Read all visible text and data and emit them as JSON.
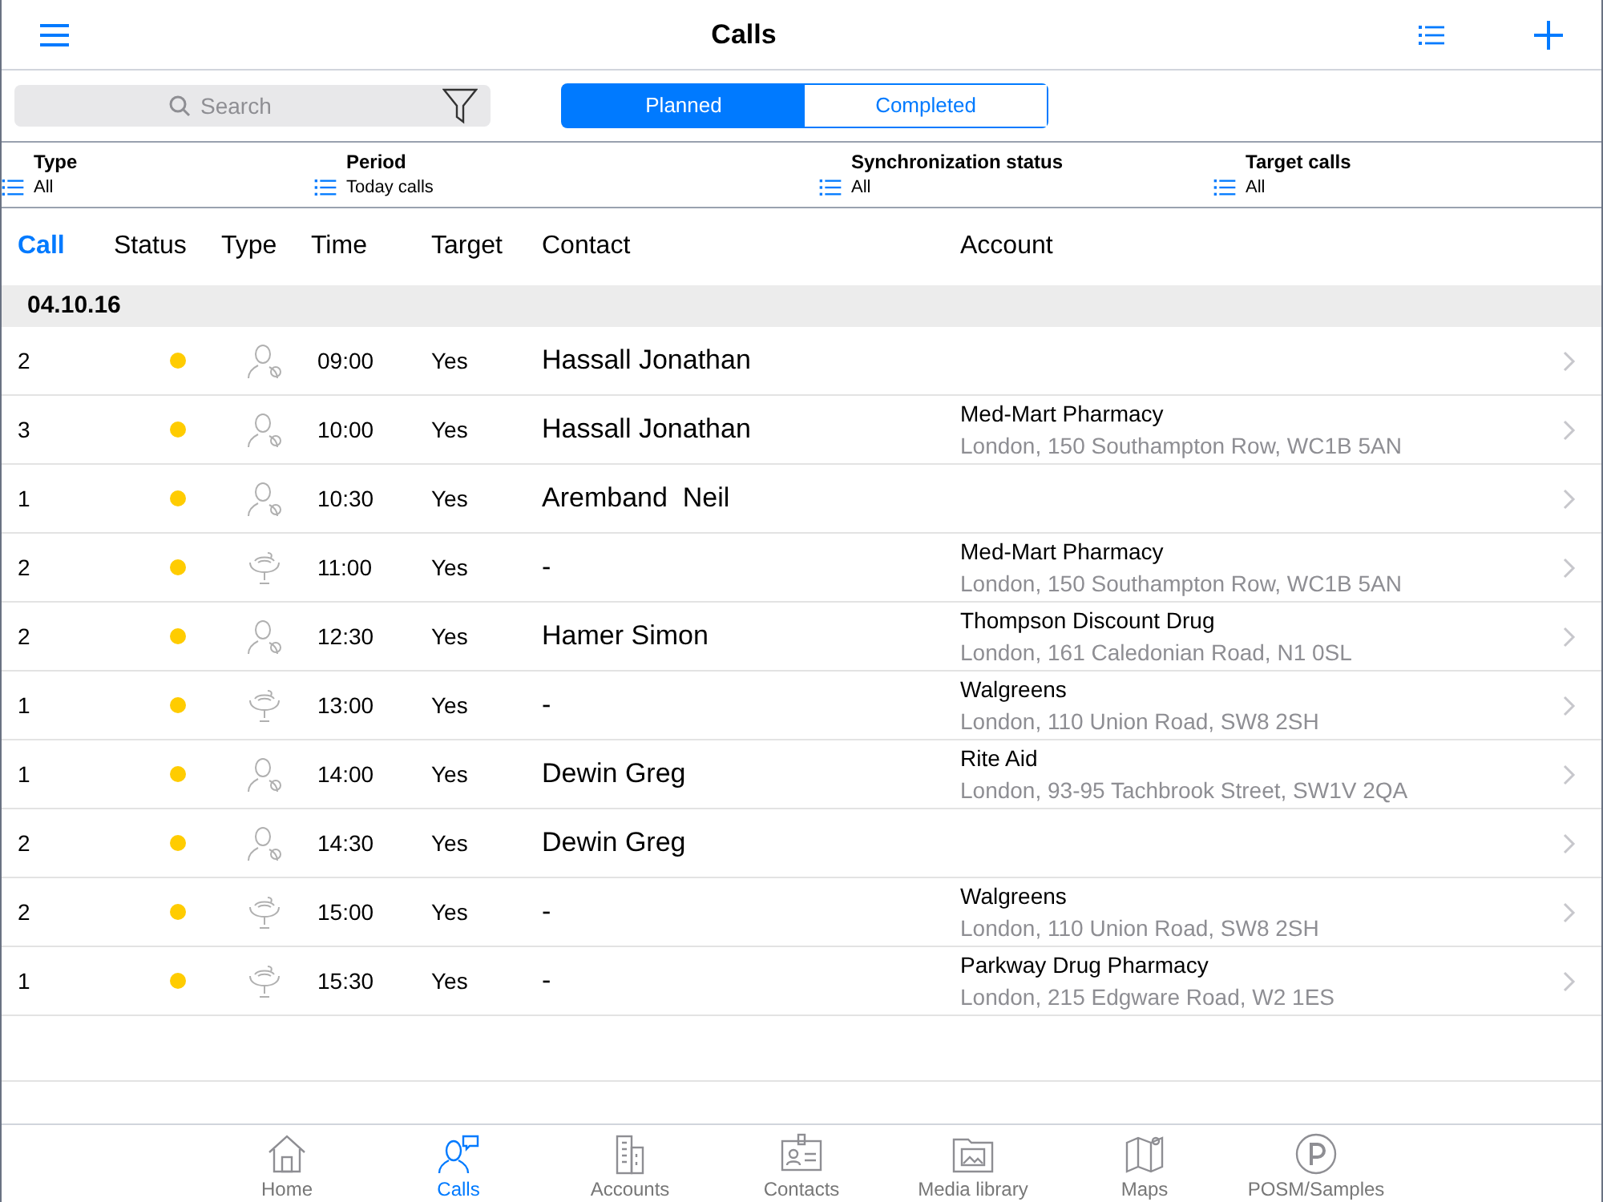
{
  "nav_bar": {
    "title": "Calls"
  },
  "search": {
    "placeholder": "Search"
  },
  "segments": [
    {
      "label": "Planned",
      "selected": true
    },
    {
      "label": "Completed",
      "selected": false
    }
  ],
  "filters": [
    {
      "label": "Type",
      "value": "All"
    },
    {
      "label": "Period",
      "value": "Today calls"
    },
    {
      "label": "Synchronization status",
      "value": "All"
    },
    {
      "label": "Target calls",
      "value": "All"
    }
  ],
  "table": {
    "columns": [
      {
        "label": "Call",
        "selected": true
      },
      {
        "label": "Status",
        "selected": false
      },
      {
        "label": "Type",
        "selected": false
      },
      {
        "label": "Time",
        "selected": false
      },
      {
        "label": "Target",
        "selected": false
      },
      {
        "label": "Contact",
        "selected": false
      },
      {
        "label": "Account",
        "selected": false
      }
    ],
    "section": "04.10.16",
    "rows": [
      {
        "call": "2",
        "color": "#ffcc00",
        "kind": "person",
        "time": "09:00",
        "target": "Yes",
        "contact": "Hassall Jonathan"
      },
      {
        "call": "3",
        "color": "#ffcc00",
        "kind": "person",
        "time": "10:00",
        "target": "Yes",
        "contact": "Hassall Jonathan",
        "account": "Med-Mart Pharmacy",
        "address": "London, 150 Southampton Row, WC1B 5AN"
      },
      {
        "call": "1",
        "color": "#ffcc00",
        "kind": "person",
        "time": "10:30",
        "target": "Yes",
        "contact": "Aremband  Neil"
      },
      {
        "call": "2",
        "color": "#ffcc00",
        "kind": "sample",
        "time": "11:00",
        "target": "Yes",
        "contact": "-",
        "account": "Med-Mart Pharmacy",
        "address": "London, 150 Southampton Row, WC1B 5AN"
      },
      {
        "call": "2",
        "color": "#ffcc00",
        "kind": "person",
        "time": "12:30",
        "target": "Yes",
        "contact": "Hamer Simon",
        "account": "Thompson Discount Drug",
        "address": "London, 161 Caledonian Road, N1 0SL"
      },
      {
        "call": "1",
        "color": "#ffcc00",
        "kind": "sample",
        "time": "13:00",
        "target": "Yes",
        "contact": "-",
        "account": "Walgreens",
        "address": "London, 110 Union Road, SW8 2SH"
      },
      {
        "call": "1",
        "color": "#ffcc00",
        "kind": "person",
        "time": "14:00",
        "target": "Yes",
        "contact": "Dewin Greg",
        "account": "Rite Aid",
        "address": "London, 93-95 Tachbrook Street, SW1V 2QA"
      },
      {
        "call": "2",
        "color": "#ffcc00",
        "kind": "person",
        "time": "14:30",
        "target": "Yes",
        "contact": "Dewin Greg"
      },
      {
        "call": "2",
        "color": "#ffcc00",
        "kind": "sample",
        "time": "15:00",
        "target": "Yes",
        "contact": "-",
        "account": "Walgreens",
        "address": "London, 110 Union Road, SW8 2SH"
      },
      {
        "call": "1",
        "color": "#ffcc00",
        "kind": "sample",
        "time": "15:30",
        "target": "Yes",
        "contact": "-",
        "account": "Parkway Drug Pharmacy",
        "address": "London, 215 Edgware Road, W2 1ES"
      }
    ]
  },
  "tab_bar": [
    {
      "label": "Home",
      "kind": "home",
      "selected": false
    },
    {
      "label": "Calls",
      "kind": "calls",
      "selected": true
    },
    {
      "label": "Accounts",
      "kind": "accounts",
      "selected": false
    },
    {
      "label": "Contacts",
      "kind": "contacts",
      "selected": false
    },
    {
      "label": "Media library",
      "kind": "media",
      "selected": false
    },
    {
      "label": "Maps",
      "kind": "maps",
      "selected": false
    },
    {
      "label": "POSM/Samples",
      "kind": "posm",
      "selected": false
    }
  ]
}
